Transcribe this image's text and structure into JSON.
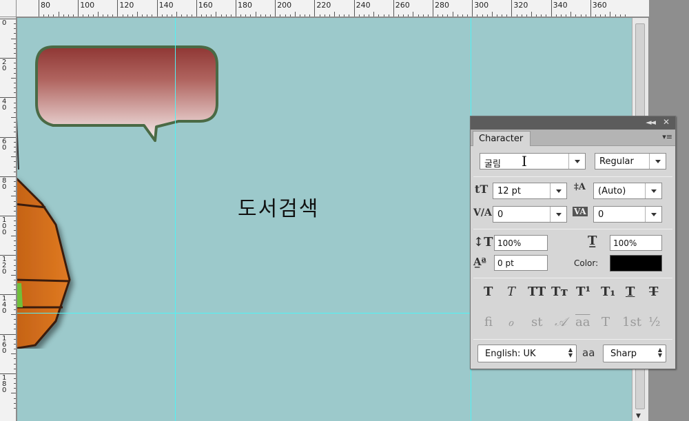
{
  "ruler": {
    "top_labels": [
      "80",
      "100",
      "120",
      "140",
      "160",
      "180",
      "200",
      "220",
      "240",
      "260",
      "280",
      "300",
      "320",
      "340",
      "360"
    ],
    "left_labels": [
      [
        "0"
      ],
      [
        "2",
        "0"
      ],
      [
        "4",
        "0"
      ],
      [
        "6",
        "0"
      ],
      [
        "8",
        "0"
      ],
      [
        "1",
        "0",
        "0"
      ],
      [
        "1",
        "2",
        "0"
      ],
      [
        "1",
        "4",
        "0"
      ],
      [
        "1",
        "6",
        "0"
      ],
      [
        "1",
        "8",
        "0"
      ]
    ]
  },
  "canvas": {
    "text": "도서검색",
    "background": "#9cc9cb",
    "guide_color": "#4ff3f5"
  },
  "character_panel": {
    "tab": "Character",
    "font_family": "굴림",
    "font_style": "Regular",
    "font_size": "12 pt",
    "leading": "(Auto)",
    "kerning": "0",
    "tracking": "0",
    "vertical_scale": "100%",
    "horizontal_scale": "100%",
    "baseline_shift": "0 pt",
    "color_label": "Color:",
    "color": "#000000",
    "style_buttons": [
      "T",
      "T",
      "TT",
      "Tт",
      "T¹",
      "T₁",
      "T",
      "T"
    ],
    "opentype_buttons": [
      "fi",
      "ℴ",
      "st",
      "𝒜",
      "aa",
      "T",
      "1st",
      "½"
    ],
    "language": "English: UK",
    "aa_icon": "aa",
    "antialias": "Sharp"
  },
  "icons": {
    "collapse": "double-left-arrow-icon",
    "close": "close-icon",
    "panel_menu": "panel-menu-icon"
  }
}
